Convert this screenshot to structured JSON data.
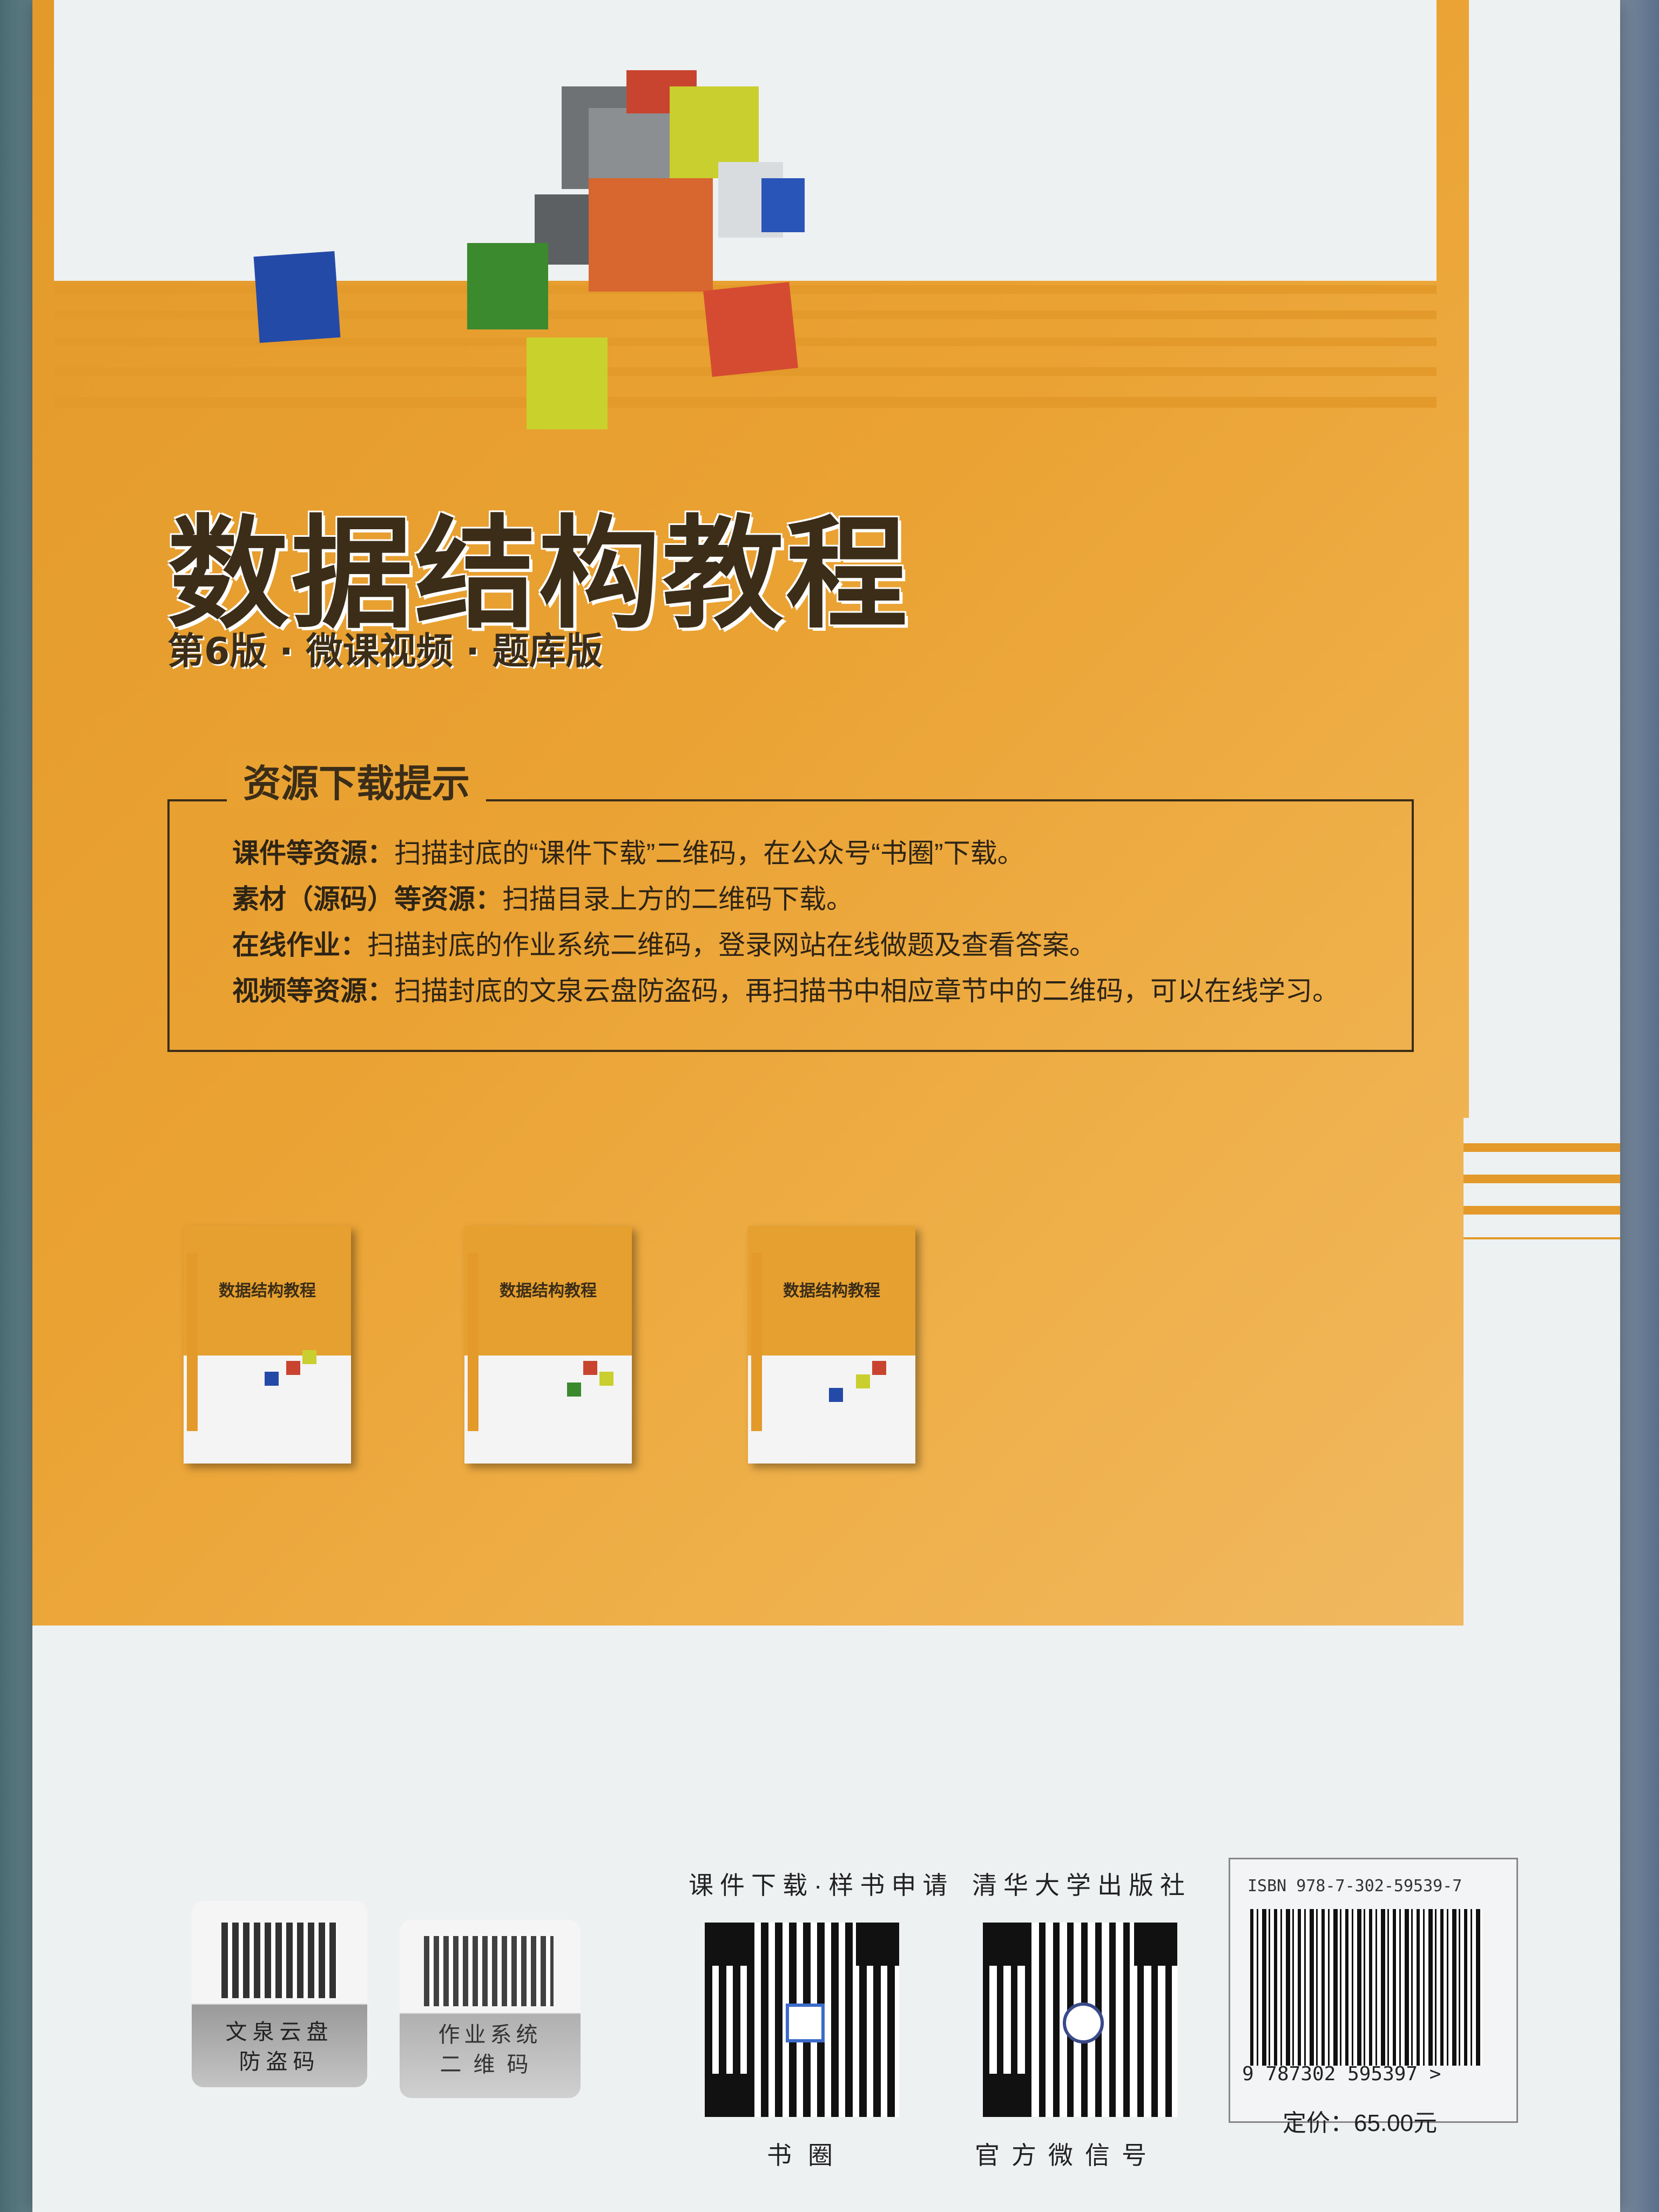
{
  "book": {
    "title": "数据结构教程",
    "subtitle": "第6版 · 微课视频 · 题库版"
  },
  "resources": {
    "heading": "资源下载提示",
    "rows": [
      {
        "label": "课件等资源：",
        "text": "扫描封底的“课件下载”二维码，在公众号“书圈”下载。"
      },
      {
        "label": "素材（源码）等资源：",
        "text": "扫描目录上方的二维码下载。"
      },
      {
        "label": "在线作业：",
        "text": "扫描封底的作业系统二维码，登录网站在线做题及查看答案。"
      },
      {
        "label": "视频等资源：",
        "text": "扫描封底的文泉云盘防盗码，再扫描书中相应章节中的二维码，可以在线学习。"
      }
    ]
  },
  "related_books": [
    {
      "title": "数据结构教程"
    },
    {
      "title": "数据结构教程"
    },
    {
      "title": "数据结构教程"
    }
  ],
  "codes": {
    "sticker1": {
      "line1": "文泉云盘",
      "line2": "防盗码"
    },
    "sticker2": {
      "line1": "作业系统",
      "line2": "二维码"
    },
    "qr1": {
      "top": "课件下载·样书申请",
      "bottom": "书圈"
    },
    "qr2": {
      "top": "清华大学出版社",
      "bottom": "官方微信号"
    }
  },
  "barcode": {
    "isbn": "ISBN 978-7-302-59539-7",
    "digits": "9 787302 595397 >",
    "price": "定价：65.00元"
  },
  "colors": {
    "orange": "#e9a232",
    "dark_text": "#3b2d18",
    "white": "#eef1f2"
  }
}
